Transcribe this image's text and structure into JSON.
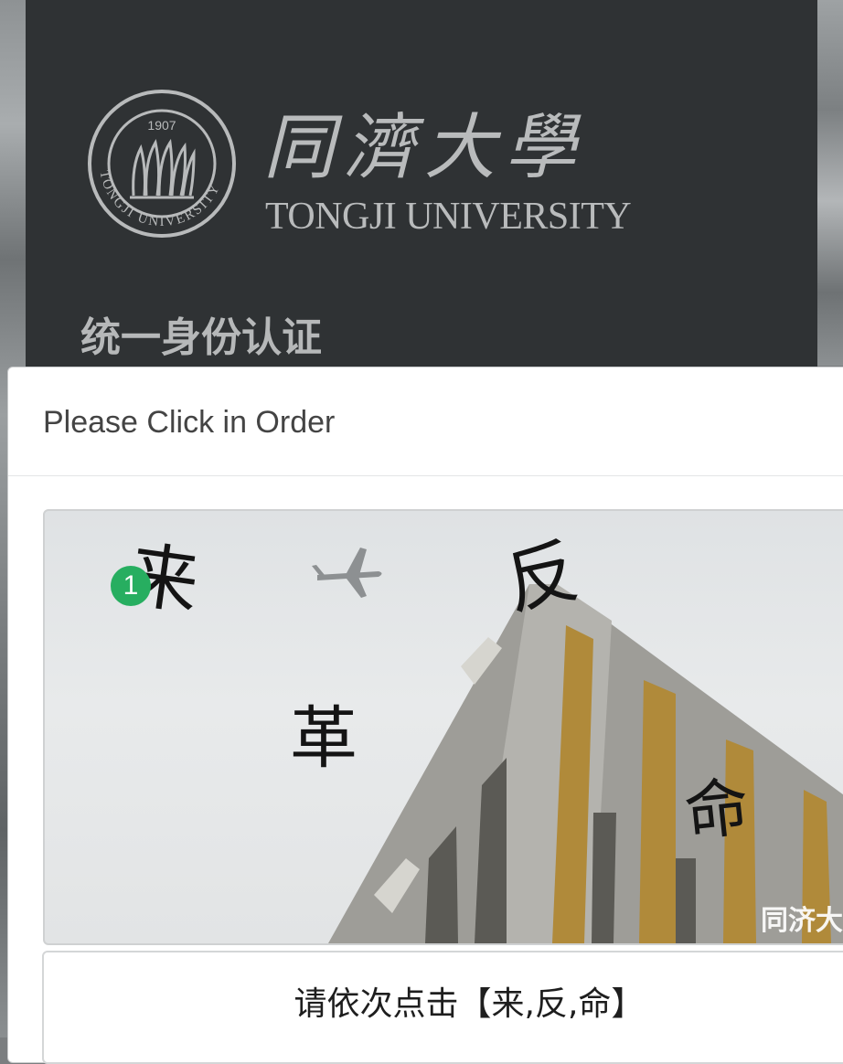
{
  "header": {
    "university_name_cn": "同濟大學",
    "university_name_en": "TONGJI UNIVERSITY",
    "logo": {
      "year": "1907",
      "ring_text": "TONGJI UNIVERSITY",
      "icon": "university-seal-icon"
    },
    "page_title": "统一身份认证"
  },
  "captcha_modal": {
    "title": "Please Click in Order",
    "image": {
      "characters": [
        "来",
        "反",
        "革",
        "命"
      ],
      "click_marker": "1",
      "watermark": "同济大"
    },
    "instruction": "请依次点击【来,反,命】"
  },
  "colors": {
    "header_bg": "#2f3234",
    "marker": "#27ae60",
    "modal_bg": "#ffffff"
  }
}
